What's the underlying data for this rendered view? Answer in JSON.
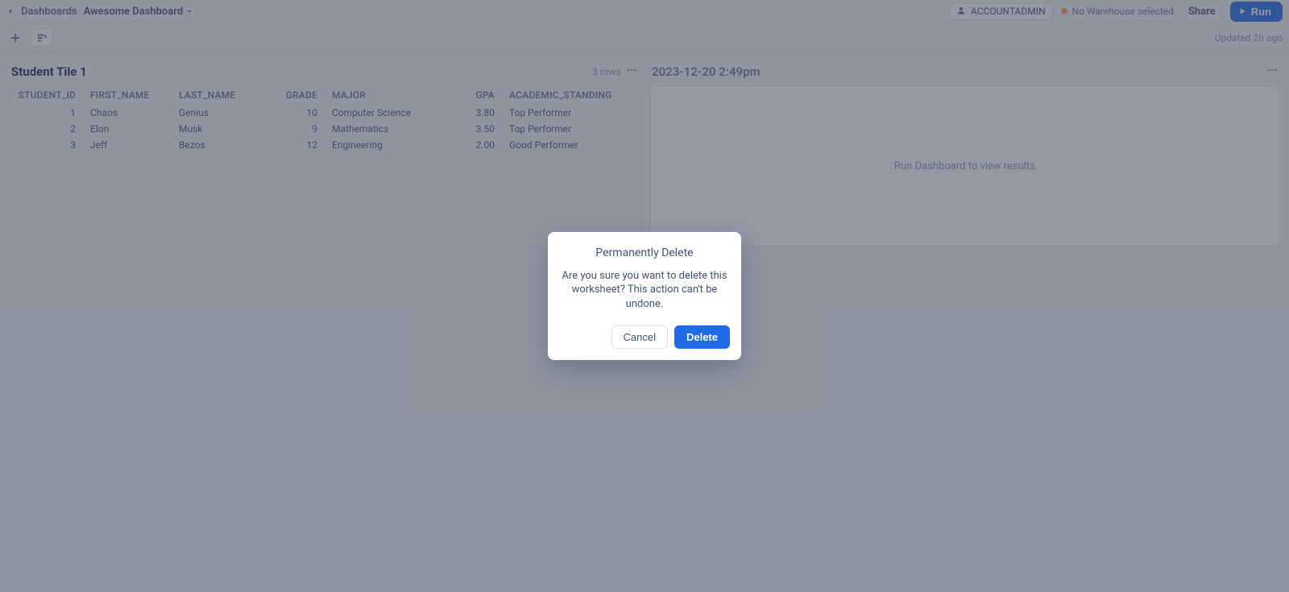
{
  "breadcrumb": {
    "back_label": "Dashboards",
    "current": "Awesome Dashboard"
  },
  "header": {
    "role": "ACCOUNTADMIN",
    "warehouse_warning": "No Warehouse selected",
    "share_label": "Share",
    "run_label": "Run"
  },
  "toolbar": {
    "updated_label": "Updated 2h ago"
  },
  "left_tile": {
    "title": "Student Tile 1",
    "row_count_label": "3 rows",
    "columns": [
      "STUDENT_ID",
      "FIRST_NAME",
      "LAST_NAME",
      "GRADE",
      "MAJOR",
      "GPA",
      "ACADEMIC_STANDING"
    ],
    "rows": [
      {
        "STUDENT_ID": "1",
        "FIRST_NAME": "Chaos",
        "LAST_NAME": "Genius",
        "GRADE": "10",
        "MAJOR": "Computer Science",
        "GPA": "3.80",
        "ACADEMIC_STANDING": "Top Performer"
      },
      {
        "STUDENT_ID": "2",
        "FIRST_NAME": "Elon",
        "LAST_NAME": "Musk",
        "GRADE": "9",
        "MAJOR": "Mathematics",
        "GPA": "3.50",
        "ACADEMIC_STANDING": "Top Performer"
      },
      {
        "STUDENT_ID": "3",
        "FIRST_NAME": "Jeff",
        "LAST_NAME": "Bezos",
        "GRADE": "12",
        "MAJOR": "Engineering",
        "GPA": "2.00",
        "ACADEMIC_STANDING": "Good Performer"
      }
    ]
  },
  "right_tile": {
    "title": "2023-12-20 2:49pm",
    "empty_message": "Run Dashboard to view results"
  },
  "modal": {
    "title": "Permanently Delete",
    "body": "Are you sure you want to delete this worksheet? This action can't be undone.",
    "cancel_label": "Cancel",
    "confirm_label": "Delete"
  }
}
